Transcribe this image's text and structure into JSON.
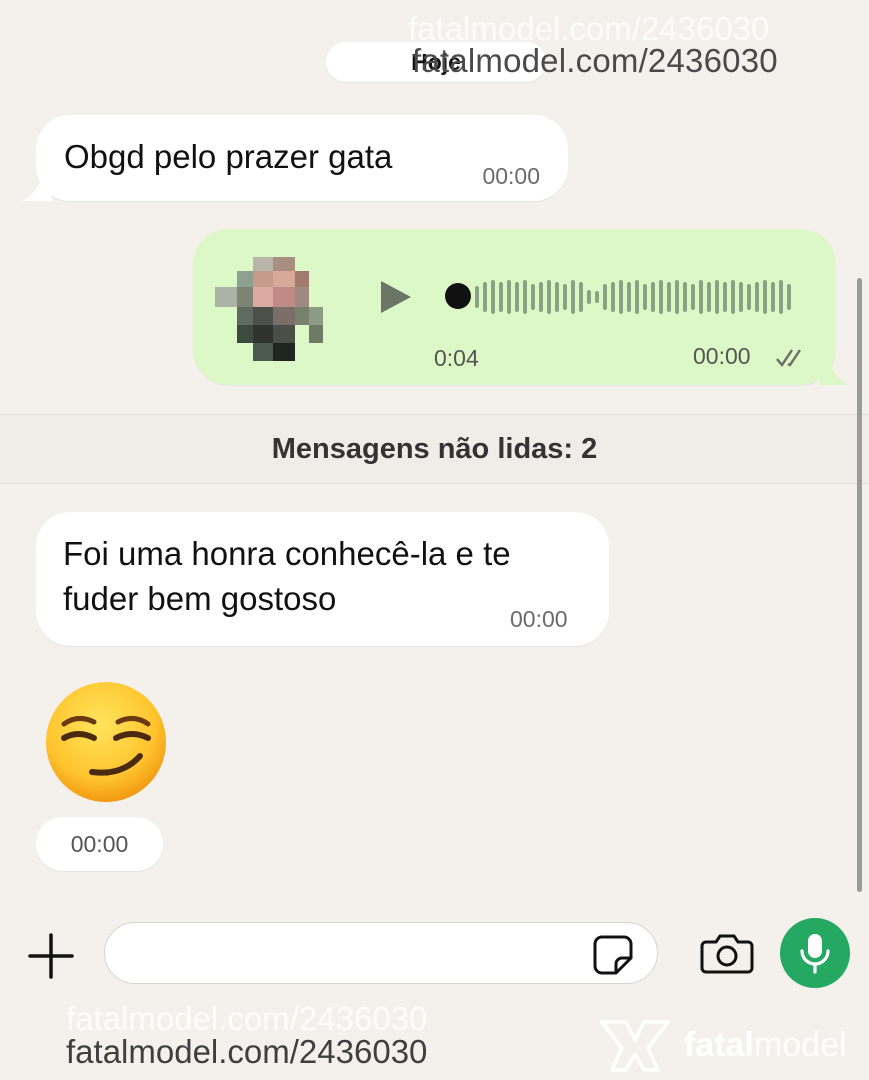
{
  "chat": {
    "date_label": "Hoje",
    "messages": [
      {
        "text": "Obgd pelo prazer gata",
        "time": "00:00"
      },
      {
        "audio_duration": "0:04",
        "time": "00:00"
      },
      {
        "line1": "Foi uma honra conhecê-la e te",
        "line2": "fuder bem gostoso",
        "time": "00:00"
      },
      {
        "emoji": "smirking-face",
        "time": "00:00"
      }
    ],
    "unread_label": "Mensagens não lidas: 2"
  },
  "composer": {
    "input_value": "",
    "icons": [
      "plus-icon",
      "sticker-icon",
      "camera-icon",
      "microphone-icon"
    ]
  },
  "watermark": {
    "url": "fatalmodel.com/2436030",
    "brand_bold": "fatal",
    "brand_light": "model"
  },
  "colors": {
    "background": "#F4F1EC",
    "outgoing_bubble": "#DCF8C6",
    "mic_button": "#25A862"
  }
}
